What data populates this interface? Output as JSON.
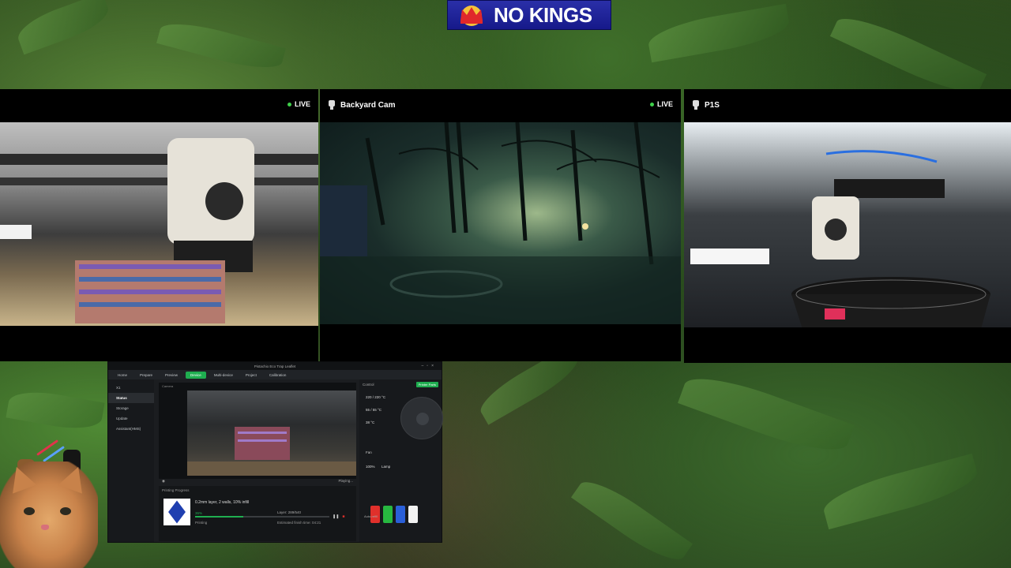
{
  "banner": {
    "text": "NO KINGS"
  },
  "cameras": [
    {
      "title": "",
      "live_label": "LIVE",
      "show_live": true
    },
    {
      "title": "Backyard Cam",
      "live_label": "LIVE",
      "show_live": true
    },
    {
      "title": "P1S",
      "live_label": "",
      "show_live": false
    }
  ],
  "slicer": {
    "title": "Pistachio Eco Trap Leaflet",
    "tabs": [
      "Home",
      "Prepare",
      "Preview",
      "Device",
      "Multi-device",
      "Project",
      "Calibration"
    ],
    "active_tab": "Device",
    "printer_name": "X1",
    "sidebar": [
      "Status",
      "Storage",
      "Update",
      "Assistant(HMS)"
    ],
    "camera_label": "Camera",
    "playing": "Playing...",
    "progress_header": "Printing Progress",
    "plate_text": "0.2mm layer, 2 walls, 10% infill",
    "percent": "36%",
    "layer": "Layer: 289/540",
    "status": "Printing",
    "finish": "Estimated finish time: 04:21",
    "control_label": "Control",
    "printer_parts": "Printer Parts",
    "temps": [
      "220 / 220 °C",
      "55 / 55 °C",
      "38 °C"
    ],
    "fan_label": "Fan",
    "lamp_label": "Lamp",
    "speed": "100%",
    "auto_refill": "Auto-refill",
    "spools": [
      {
        "label": "PLA",
        "color": "#e0302b"
      },
      {
        "label": "PLA",
        "color": "#27b840"
      },
      {
        "label": "PLA",
        "color": "#2a5fd8"
      },
      {
        "label": "PLA",
        "color": "#f2f2f2"
      }
    ]
  }
}
